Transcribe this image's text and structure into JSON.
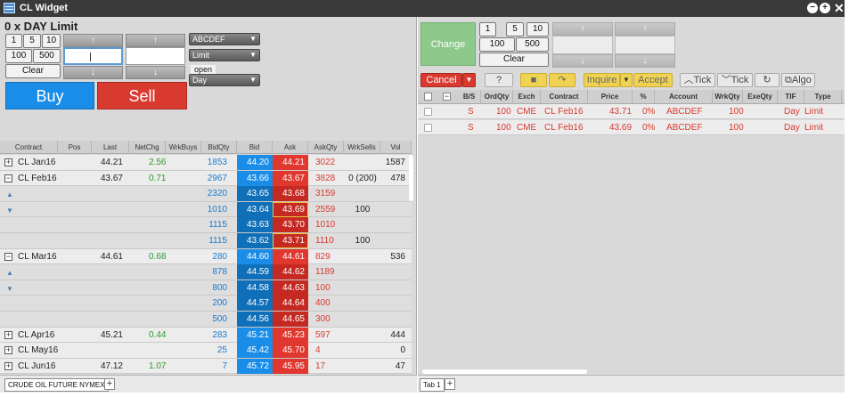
{
  "window": {
    "title": "CL Widget",
    "controls": [
      "minimize",
      "maximize",
      "close"
    ]
  },
  "order_entry": {
    "title": "0 x DAY Limit",
    "qty_buttons": [
      "1",
      "5",
      "10",
      "100",
      "500"
    ],
    "clear_label": "Clear",
    "account": "ABCDEF",
    "order_type": "Limit",
    "open_label": "open",
    "tif": "Day",
    "buy_label": "Buy",
    "sell_label": "Sell",
    "arrow_up": "↑",
    "arrow_down": "↓",
    "dd_arrow": "▼"
  },
  "ladder": {
    "columns": [
      "Contract",
      "Pos",
      "Last",
      "NetChg",
      "WrkBuys",
      "BidQty",
      "Bid",
      "Ask",
      "AskQty",
      "WrkSells",
      "Vol"
    ],
    "rows": [
      {
        "kind": "main",
        "expander": "+",
        "contract": "CL Jan16",
        "pos": "",
        "last": "44.21",
        "netchg": "2.56",
        "wrkbuys": "",
        "bidqty": "1853",
        "bid": "44.20",
        "ask": "44.21",
        "askqty": "3022",
        "wrksells": "",
        "vol": "1587"
      },
      {
        "kind": "main",
        "expander": "−",
        "contract": "CL Feb16",
        "pos": "",
        "last": "43.67",
        "netchg": "0.71",
        "wrkbuys": "",
        "bidqty": "2967",
        "bid": "43.66",
        "ask": "43.67",
        "askqty": "3828",
        "wrksells": "0 (200)",
        "vol": "478"
      },
      {
        "kind": "depth",
        "marker": "▲",
        "bidqty": "2320",
        "bid": "43.65",
        "ask": "43.68",
        "askqty": "3159",
        "wrksells": ""
      },
      {
        "kind": "depth",
        "marker": "▼",
        "bidqty": "1010",
        "bid": "43.64",
        "ask": "43.69",
        "askqty": "2559",
        "wrksells": "100",
        "highlight": true
      },
      {
        "kind": "depth",
        "marker": "",
        "bidqty": "1115",
        "bid": "43.63",
        "ask": "43.70",
        "askqty": "1010",
        "wrksells": ""
      },
      {
        "kind": "depth",
        "marker": "",
        "bidqty": "1115",
        "bid": "43.62",
        "ask": "43.71",
        "askqty": "1110",
        "wrksells": "100",
        "highlight": true
      },
      {
        "kind": "main",
        "expander": "−",
        "contract": "CL Mar16",
        "pos": "",
        "last": "44.61",
        "netchg": "0.68",
        "wrkbuys": "",
        "bidqty": "280",
        "bid": "44.60",
        "ask": "44.61",
        "askqty": "829",
        "wrksells": "",
        "vol": "536"
      },
      {
        "kind": "depth",
        "marker": "▲",
        "bidqty": "878",
        "bid": "44.59",
        "ask": "44.62",
        "askqty": "1189",
        "wrksells": ""
      },
      {
        "kind": "depth",
        "marker": "▼",
        "bidqty": "800",
        "bid": "44.58",
        "ask": "44.63",
        "askqty": "100",
        "wrksells": ""
      },
      {
        "kind": "depth",
        "marker": "",
        "bidqty": "200",
        "bid": "44.57",
        "ask": "44.64",
        "askqty": "400",
        "wrksells": ""
      },
      {
        "kind": "depth",
        "marker": "",
        "bidqty": "500",
        "bid": "44.56",
        "ask": "44.65",
        "askqty": "300",
        "wrksells": ""
      },
      {
        "kind": "main",
        "expander": "+",
        "contract": "CL Apr16",
        "pos": "",
        "last": "45.21",
        "netchg": "0.44",
        "wrkbuys": "",
        "bidqty": "283",
        "bid": "45.21",
        "ask": "45.23",
        "askqty": "597",
        "wrksells": "",
        "vol": "444"
      },
      {
        "kind": "main",
        "expander": "+",
        "contract": "CL May16",
        "pos": "",
        "last": "",
        "netchg": "",
        "wrkbuys": "",
        "bidqty": "25",
        "bid": "45.42",
        "ask": "45.70",
        "askqty": "4",
        "wrksells": "",
        "vol": "0"
      },
      {
        "kind": "main",
        "expander": "+",
        "contract": "CL Jun16",
        "pos": "",
        "last": "47.12",
        "netchg": "1.07",
        "wrkbuys": "",
        "bidqty": "7",
        "bid": "45.72",
        "ask": "45.95",
        "askqty": "17",
        "wrksells": "",
        "vol": "47"
      }
    ]
  },
  "left_tabs": {
    "tab_label": "CRUDE OIL FUTURE NYMEX",
    "add_label": "+"
  },
  "change_panel": {
    "change_label": "Change",
    "qty_buttons": [
      "1",
      "5",
      "10",
      "100",
      "500"
    ],
    "clear_label": "Clear"
  },
  "orders_toolbar": {
    "cancel_label": "Cancel",
    "help_label": "?",
    "stop_icon": "■",
    "forward_icon": "↷",
    "inquire_label": "Inquire",
    "accept_label": "Accept",
    "tick_up_label": "Tick",
    "tick_down_label": "Tick",
    "refresh_icon": "↻",
    "algo_label": "Algo"
  },
  "orders": {
    "columns": [
      "B/S",
      "OrdQty",
      "Exch",
      "Contract",
      "Price",
      "%",
      "Account",
      "WrkQty",
      "ExeQty",
      "TIF",
      "Type"
    ],
    "rows": [
      {
        "bs": "S",
        "ordqty": "100",
        "exch": "CME",
        "contract": "CL Feb16",
        "price": "43.71",
        "pct": "0%",
        "account": "ABCDEF",
        "wrkqty": "100",
        "exeqty": "",
        "tif": "Day",
        "type": "Limit"
      },
      {
        "bs": "S",
        "ordqty": "100",
        "exch": "CME",
        "contract": "CL Feb16",
        "price": "43.69",
        "pct": "0%",
        "account": "ABCDEF",
        "wrkqty": "100",
        "exeqty": "",
        "tif": "Day",
        "type": "Limit"
      }
    ]
  },
  "right_tabs": {
    "tab_label": "Tab 1",
    "add_label": "+"
  },
  "colors": {
    "bid": "#1a8de8",
    "ask": "#e0382e",
    "buy": "#1a8de8",
    "sell": "#d93a30",
    "change": "#8cc98a",
    "inquire": "#f0d253"
  }
}
